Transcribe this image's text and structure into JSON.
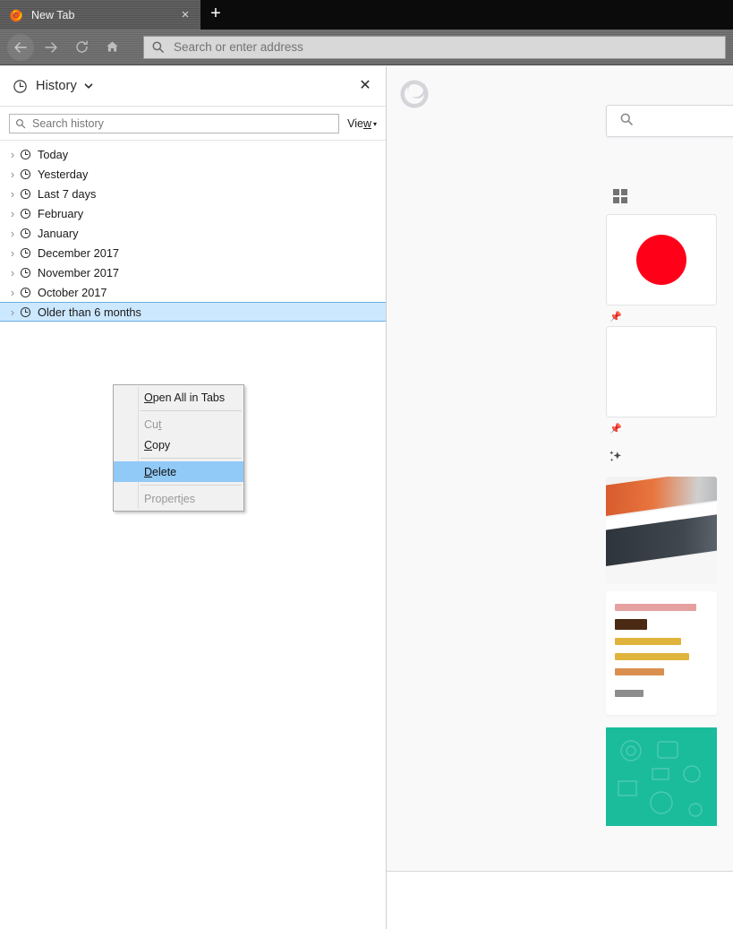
{
  "browser": {
    "tab": {
      "title": "New Tab",
      "favicon_icon": "firefox-logo-icon",
      "close_icon": "×"
    },
    "new_tab_button_label": "+",
    "toolbar": {
      "back_icon": "arrow-left-icon",
      "forward_icon": "arrow-right-icon",
      "reload_icon": "reload-icon",
      "home_icon": "home-icon",
      "address_bar": {
        "value": "",
        "placeholder": "Search or enter address",
        "icon": "search-icon"
      }
    }
  },
  "sidebar": {
    "header": {
      "icon": "clock-icon",
      "title": "History",
      "dropdown_icon": "chevron-down-icon",
      "close_label": "✕"
    },
    "search": {
      "value": "",
      "placeholder": "Search history",
      "icon": "search-icon"
    },
    "view_menu": {
      "prefix": "Vie",
      "accesskey": "w",
      "caret": "▾"
    },
    "tree_items": [
      {
        "label": "Today",
        "icon": "clock-icon",
        "twisty": "›",
        "selected": false
      },
      {
        "label": "Yesterday",
        "icon": "clock-icon",
        "twisty": "›",
        "selected": false
      },
      {
        "label": "Last 7 days",
        "icon": "clock-icon",
        "twisty": "›",
        "selected": false
      },
      {
        "label": "February",
        "icon": "clock-icon",
        "twisty": "›",
        "selected": false
      },
      {
        "label": "January",
        "icon": "clock-icon",
        "twisty": "›",
        "selected": false
      },
      {
        "label": "December 2017",
        "icon": "clock-icon",
        "twisty": "›",
        "selected": false
      },
      {
        "label": "November 2017",
        "icon": "clock-icon",
        "twisty": "›",
        "selected": false
      },
      {
        "label": "October 2017",
        "icon": "clock-icon",
        "twisty": "›",
        "selected": false
      },
      {
        "label": "Older than 6 months",
        "icon": "clock-icon",
        "twisty": "›",
        "selected": true
      }
    ]
  },
  "context_menu": {
    "items": [
      {
        "pre": "",
        "accesskey": "O",
        "post": "pen All in Tabs",
        "state": "enabled"
      },
      {
        "pre": "Cu",
        "accesskey": "t",
        "post": "",
        "state": "disabled"
      },
      {
        "pre": "",
        "accesskey": "C",
        "post": "opy",
        "state": "enabled"
      },
      {
        "pre": "",
        "accesskey": "D",
        "post": "elete",
        "state": "highlighted"
      },
      {
        "pre": "Propert",
        "accesskey": "i",
        "post": "es",
        "state": "disabled"
      }
    ]
  },
  "newtab": {
    "watermark_icon": "firefox-logo-watermark-icon",
    "search_icon": "search-icon",
    "grid_icon": "top-sites-grid-icon",
    "pin_icon": "pin-icon",
    "sparkle_icon": "highlights-sparkle-icon"
  },
  "colors": {
    "tab_bar": "#0b0b0b",
    "tab_active": "#5b5b5b",
    "toolbar": "#6e6e6e",
    "sidebar_bg": "#ffffff",
    "tree_selection": "#cce8ff",
    "tree_selection_border": "#6aaee0",
    "menu_bg": "#f1f1f1",
    "menu_highlight": "#91c9f7",
    "newtab_bg": "#f9f9fa",
    "accent_red": "#ff0019",
    "accent_teal": "#1abc9c"
  }
}
